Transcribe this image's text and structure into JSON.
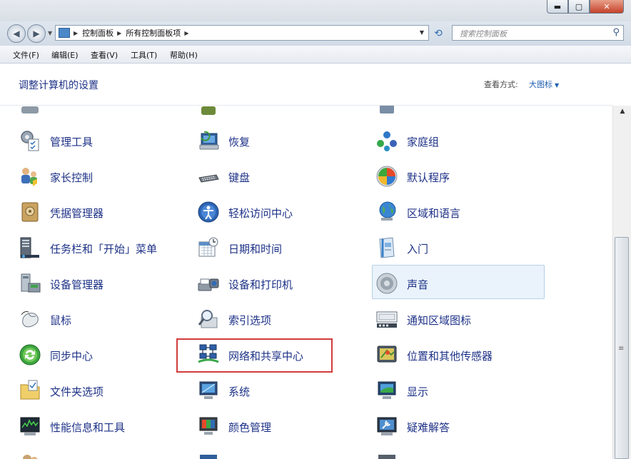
{
  "navigation": {
    "breadcrumbs": [
      "控制面板",
      "所有控制面板项"
    ],
    "search_placeholder": "搜索控制面板"
  },
  "menubar": [
    {
      "label": "文件(F)"
    },
    {
      "label": "编辑(E)"
    },
    {
      "label": "查看(V)"
    },
    {
      "label": "工具(T)"
    },
    {
      "label": "帮助(H)"
    }
  ],
  "header": {
    "title": "调整计算机的设置",
    "view_by_label": "查看方式:",
    "view_by_value": "大图标"
  },
  "items": [
    {
      "label": "管理工具",
      "icon": "admin-tools-icon"
    },
    {
      "label": "恢复",
      "icon": "recovery-icon"
    },
    {
      "label": "家庭组",
      "icon": "homegroup-icon"
    },
    {
      "label": "家长控制",
      "icon": "parental-controls-icon"
    },
    {
      "label": "键盘",
      "icon": "keyboard-icon"
    },
    {
      "label": "默认程序",
      "icon": "default-programs-icon"
    },
    {
      "label": "凭据管理器",
      "icon": "credential-manager-icon"
    },
    {
      "label": "轻松访问中心",
      "icon": "ease-of-access-icon"
    },
    {
      "label": "区域和语言",
      "icon": "region-language-icon"
    },
    {
      "label": "任务栏和「开始」菜单",
      "icon": "taskbar-icon"
    },
    {
      "label": "日期和时间",
      "icon": "date-time-icon"
    },
    {
      "label": "入门",
      "icon": "getting-started-icon"
    },
    {
      "label": "设备管理器",
      "icon": "device-manager-icon"
    },
    {
      "label": "设备和打印机",
      "icon": "devices-printers-icon"
    },
    {
      "label": "声音",
      "icon": "sound-icon"
    },
    {
      "label": "鼠标",
      "icon": "mouse-icon"
    },
    {
      "label": "索引选项",
      "icon": "indexing-options-icon"
    },
    {
      "label": "通知区域图标",
      "icon": "notification-area-icon"
    },
    {
      "label": "同步中心",
      "icon": "sync-center-icon"
    },
    {
      "label": "网络和共享中心",
      "icon": "network-sharing-icon"
    },
    {
      "label": "位置和其他传感器",
      "icon": "location-sensors-icon"
    },
    {
      "label": "文件夹选项",
      "icon": "folder-options-icon"
    },
    {
      "label": "系统",
      "icon": "system-icon"
    },
    {
      "label": "显示",
      "icon": "display-icon"
    },
    {
      "label": "性能信息和工具",
      "icon": "performance-icon"
    },
    {
      "label": "颜色管理",
      "icon": "color-management-icon"
    },
    {
      "label": "疑难解答",
      "icon": "troubleshooting-icon"
    }
  ]
}
